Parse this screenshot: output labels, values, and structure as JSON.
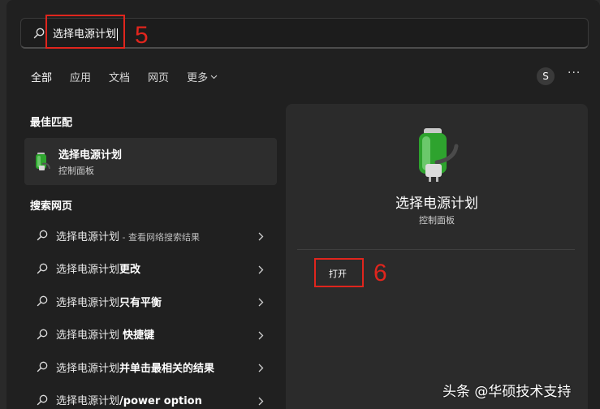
{
  "search": {
    "query": "选择电源计划"
  },
  "tabs": [
    {
      "label": "全部"
    },
    {
      "label": "应用"
    },
    {
      "label": "文档"
    },
    {
      "label": "网页"
    },
    {
      "label": "更多"
    }
  ],
  "header": {
    "avatar_letter": "S",
    "more_glyph": "···"
  },
  "best_match": {
    "heading": "最佳匹配",
    "title": "选择电源计划",
    "subtitle": "控制面板"
  },
  "web": {
    "heading": "搜索网页",
    "items": [
      {
        "prefix": "选择电源计划",
        "bold": "",
        "suffix": " - 查看网络搜索结果"
      },
      {
        "prefix": "选择电源计划",
        "bold": "更改",
        "suffix": ""
      },
      {
        "prefix": "选择电源计划",
        "bold": "只有平衡",
        "suffix": ""
      },
      {
        "prefix": "选择电源计划 ",
        "bold": "快捷键",
        "suffix": ""
      },
      {
        "prefix": "选择电源计划",
        "bold": "并单击最相关的结果",
        "suffix": ""
      },
      {
        "prefix": "选择电源计划",
        "bold": "/power option",
        "suffix": ""
      }
    ]
  },
  "preview": {
    "title": "选择电源计划",
    "subtitle": "控制面板",
    "open_label": "打开"
  },
  "annotations": {
    "step5": "5",
    "step6": "6",
    "color": "#e0251d"
  },
  "watermark": "头条 @华硕技术支持"
}
